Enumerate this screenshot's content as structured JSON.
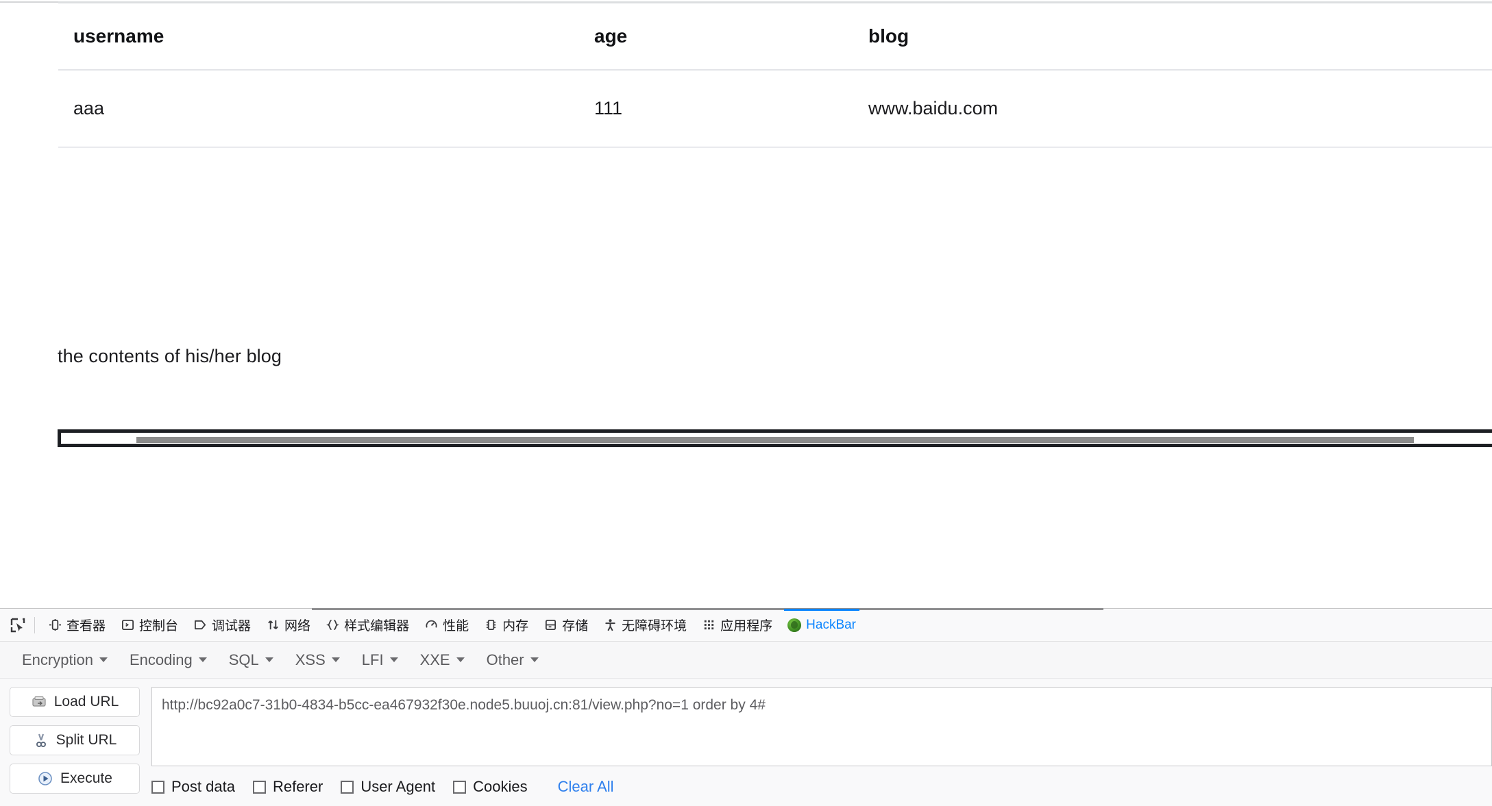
{
  "page": {
    "table": {
      "columns": [
        "username",
        "age",
        "blog"
      ],
      "rows": [
        {
          "username": "aaa",
          "age": "111",
          "blog": "www.baidu.com"
        }
      ]
    },
    "blog_contents_label": "the contents of his/her blog"
  },
  "devtools": {
    "picker_icon": "element-picker-icon",
    "tabs": [
      {
        "label": "查看器",
        "icon": "inspector-icon",
        "selected": false
      },
      {
        "label": "控制台",
        "icon": "console-icon",
        "selected": false
      },
      {
        "label": "调试器",
        "icon": "debugger-icon",
        "selected": false
      },
      {
        "label": "网络",
        "icon": "network-icon",
        "selected": false
      },
      {
        "label": "样式编辑器",
        "icon": "style-editor-icon",
        "selected": false
      },
      {
        "label": "性能",
        "icon": "performance-icon",
        "selected": false
      },
      {
        "label": "内存",
        "icon": "memory-icon",
        "selected": false
      },
      {
        "label": "存储",
        "icon": "storage-icon",
        "selected": false
      },
      {
        "label": "无障碍环境",
        "icon": "accessibility-icon",
        "selected": false
      },
      {
        "label": "应用程序",
        "icon": "application-icon",
        "selected": false
      },
      {
        "label": "HackBar",
        "icon": "hackbar-icon",
        "selected": true
      }
    ],
    "selected_tab": "HackBar",
    "accent_color": "#0a84ff"
  },
  "hackbar": {
    "menus": [
      {
        "label": "Encryption"
      },
      {
        "label": "Encoding"
      },
      {
        "label": "SQL"
      },
      {
        "label": "XSS"
      },
      {
        "label": "LFI"
      },
      {
        "label": "XXE"
      },
      {
        "label": "Other"
      }
    ],
    "buttons": [
      {
        "label": "Load URL",
        "icon": "load-url-icon"
      },
      {
        "label": "Split URL",
        "icon": "split-url-icon"
      },
      {
        "label": "Execute",
        "icon": "execute-icon"
      }
    ],
    "url_value": "http://bc92a0c7-31b0-4834-b5cc-ea467932f30e.node5.buuoj.cn:81/view.php?no=1 order by 4#",
    "url_placeholder": "",
    "options": [
      {
        "label": "Post data",
        "checked": false
      },
      {
        "label": "Referer",
        "checked": false
      },
      {
        "label": "User Agent",
        "checked": false
      },
      {
        "label": "Cookies",
        "checked": false
      }
    ],
    "clear_all_label": "Clear All",
    "link_color": "#2f80ed"
  }
}
